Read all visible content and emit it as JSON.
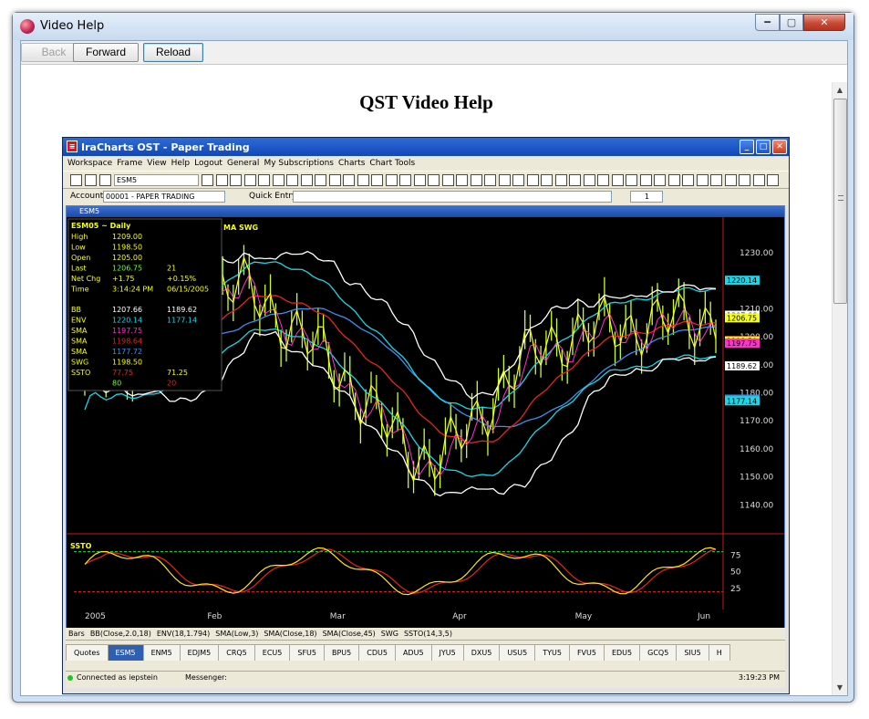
{
  "window": {
    "title": "Video Help"
  },
  "nav": {
    "back": "Back",
    "forward": "Forward",
    "reload": "Reload"
  },
  "page": {
    "title": "QST Video Help"
  },
  "screenshot": {
    "title": "IraCharts OST - Paper Trading",
    "menu": [
      "Workspace",
      "Frame",
      "View",
      "Help",
      "Logout",
      "General",
      "My Subscriptions",
      "Charts",
      "Chart Tools"
    ],
    "symbol": "ESM5",
    "account_label": "Account:",
    "account_value": "00001 - PAPER TRADING",
    "quick_entry_label": "Quick Entry:",
    "quantity": "1",
    "chart_window_title": "ESM5",
    "legend_items": [
      "Bars",
      "BB(Close,2.0,18)",
      "ENV(18,1.794)",
      "SMA(Low,3)",
      "SMA(Close,18)",
      "SMA(Close,45)",
      "SWG",
      "SSTO(14,3,5)"
    ],
    "tabs": [
      "Quotes",
      "ESM5",
      "ENM5",
      "EDJM5",
      "CRQ5",
      "ECU5",
      "SFU5",
      "BPU5",
      "CDU5",
      "ADU5",
      "JYU5",
      "DXU5",
      "USU5",
      "TYU5",
      "FVU5",
      "EDU5",
      "GCQ5",
      "SIU5",
      "H"
    ],
    "status_connection": "Connected as iepstein",
    "status_messenger": "Messenger:",
    "status_time": "3:19:23 PM"
  },
  "chart_data": {
    "type": "candlestick",
    "symbol": "ESM05 ~ Daily",
    "x_labels": [
      "2005",
      "Feb",
      "Mar",
      "Apr",
      "May",
      "Jun"
    ],
    "y_ticks": [
      1230,
      1210,
      1200,
      1190,
      1180,
      1170,
      1160,
      1150,
      1140
    ],
    "ylim": [
      1132,
      1242
    ],
    "price_tags": [
      {
        "value": "1220.14",
        "color": "#1ad6e6"
      },
      {
        "value": "1207.66",
        "color": "#ffffff"
      },
      {
        "value": "1206.75",
        "color": "#f5ff1a"
      },
      {
        "value": "1198.64",
        "color": "#e8261d"
      },
      {
        "value": "1198.50",
        "color": "#f5ff1a"
      },
      {
        "value": "1197.75",
        "color": "#ff33cc"
      },
      {
        "value": "1189.62",
        "color": "#ffffff"
      },
      {
        "value": "1177.72",
        "color": "#3b8ef0"
      },
      {
        "value": "1177.14",
        "color": "#1ad6e6"
      }
    ],
    "data_box": {
      "rows": [
        [
          "High",
          "1209.00",
          ""
        ],
        [
          "Low",
          "1198.50",
          ""
        ],
        [
          "Open",
          "1205.00",
          ""
        ],
        [
          "Last",
          "1206.75",
          "21"
        ],
        [
          "Net Chg",
          "+1.75",
          "+0.15%"
        ],
        [
          "Time",
          "3:14:24 PM",
          "06/15/2005"
        ]
      ],
      "indicators": [
        [
          "BB",
          "1207.66",
          "1189.62"
        ],
        [
          "ENV",
          "1220.14",
          "1177.14"
        ],
        [
          "SMA",
          "1197.75",
          ""
        ],
        [
          "SMA",
          "1198.64",
          ""
        ],
        [
          "SMA",
          "1177.72",
          ""
        ],
        [
          "SWG",
          "1198.50",
          ""
        ],
        [
          "SSTO",
          "77.75",
          "71.25"
        ],
        [
          "",
          "80",
          "20"
        ]
      ]
    },
    "header_label": "MA SWG",
    "ssto": {
      "label": "SSTO",
      "ticks": [
        75,
        50,
        25
      ],
      "upper": 80,
      "lower": 20
    },
    "colors": {
      "bars": "#c8ff2e",
      "swg": "#f5ff1a",
      "bb": "#ffffff",
      "env": "#1ad6e6",
      "sma_low": "#ff33cc",
      "sma18": "#e8261d",
      "sma45": "#3b8ef0",
      "ssto_k": "#ffe51a",
      "ssto_d": "#e8261d"
    }
  }
}
